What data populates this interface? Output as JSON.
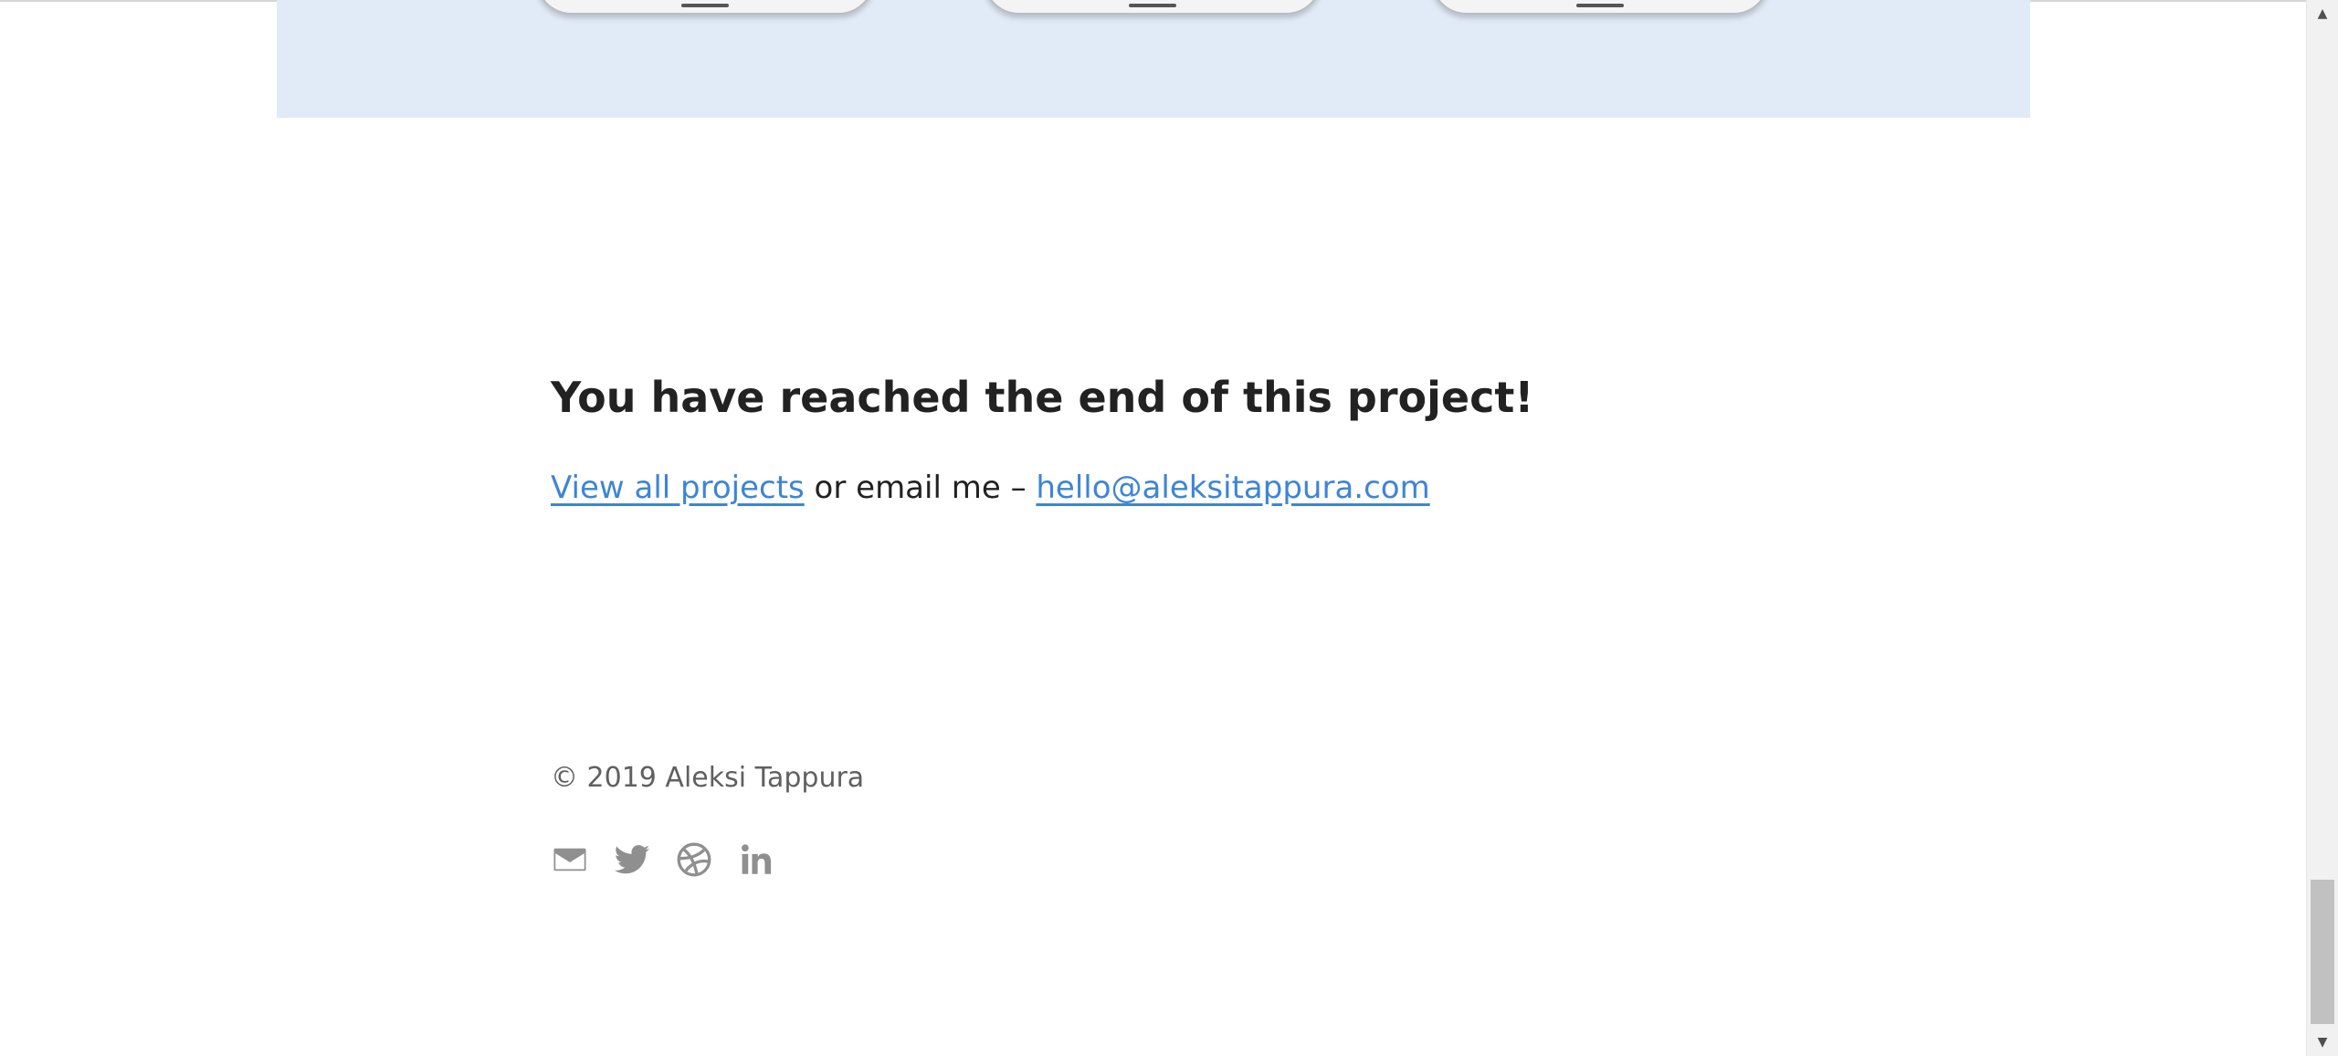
{
  "end_section": {
    "title": "You have reached the end of this project!",
    "view_all_link": "View all projects",
    "connector_text": " or email me – ",
    "email_link": "hello@aleksitappura.com"
  },
  "footer": {
    "copyright": "© 2019 Aleksi Tappura",
    "social_icons": [
      "mail-icon",
      "twitter-icon",
      "dribbble-icon",
      "linkedin-icon"
    ]
  },
  "colors": {
    "link": "#3d85d6",
    "heading": "#222222",
    "muted": "#606060",
    "icon": "#8f8f8f",
    "showcase_background": "#e1ebf7"
  },
  "scrollbar": {
    "position_fraction": 0.93
  }
}
